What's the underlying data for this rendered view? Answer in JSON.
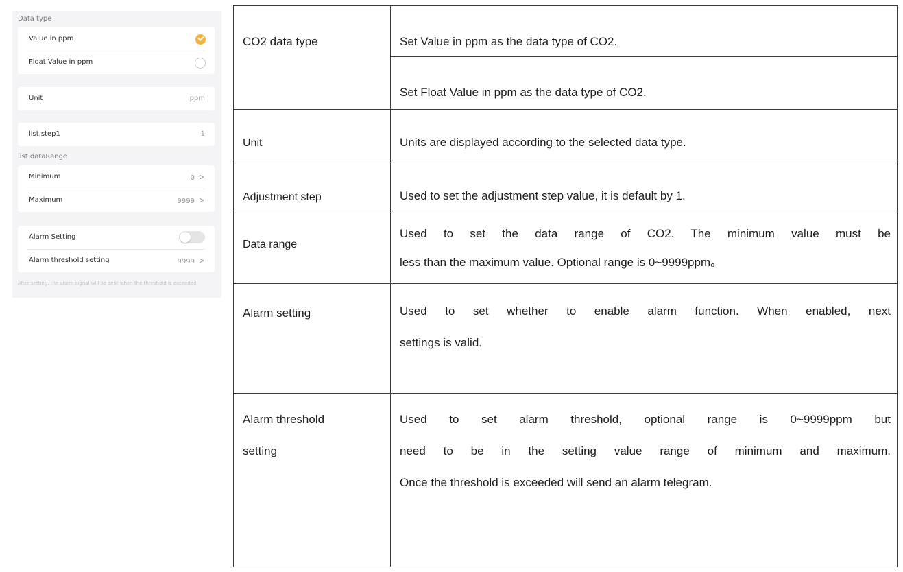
{
  "phone": {
    "data_type_label": "Data type",
    "value_in_ppm": "Value in ppm",
    "float_value_in_ppm": "Float Value in ppm",
    "unit_label": "Unit",
    "unit_value": "ppm",
    "step_label": "list.step1",
    "step_value": "1",
    "data_range_label": "list.dataRange",
    "minimum_label": "Minimum",
    "minimum_value": "0",
    "maximum_label": "Maximum",
    "maximum_value": "9999",
    "alarm_setting_label": "Alarm Setting",
    "alarm_enabled": false,
    "alarm_threshold_label": "Alarm threshold setting",
    "alarm_threshold_value": "9999",
    "note": "After setting, the alarm signal will be sent when the threshold is exceeded.",
    "selected_data_type": "Value in ppm",
    "accent_color": "#f7b23b"
  },
  "table": {
    "co2_type": {
      "label": "CO2 data type",
      "desc_a": "Set Value in ppm as the data type of CO2.",
      "desc_b": "Set Float Value in ppm as the data type of CO2."
    },
    "unit": {
      "label": "Unit",
      "desc": "Units are displayed according to the selected data type."
    },
    "step": {
      "label": "Adjustment step",
      "desc": "Used to set the adjustment step value, it is default by 1."
    },
    "range": {
      "label": "Data range",
      "desc_1": "Used to set the data range of CO2. The minimum value must be",
      "desc_2": "less than the maximum value. Optional range is 0~9999ppm。"
    },
    "alarm": {
      "label": "Alarm setting",
      "desc_1": "Used to set whether to enable alarm function. When enabled, next",
      "desc_2": "settings is valid."
    },
    "threshold": {
      "label_1": "Alarm threshold",
      "label_2": "setting",
      "desc_1": "Used to set alarm threshold, optional range is 0~9999ppm but",
      "desc_2": "need to be in the setting value range of minimum and maximum.",
      "desc_3": "Once the threshold is exceeded will send an alarm telegram."
    }
  }
}
